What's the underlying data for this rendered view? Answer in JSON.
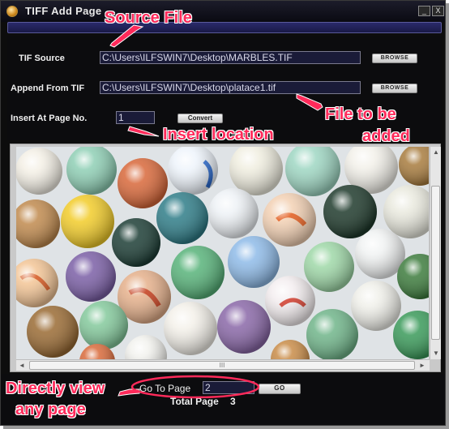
{
  "window": {
    "title": "TIFF Add Page",
    "minimize_glyph": "_",
    "close_glyph": "X"
  },
  "form": {
    "tif_source_label": "TIF Source",
    "tif_source_value": "C:\\Users\\ILFSWIN7\\Desktop\\MARBLES.TIF",
    "append_label": "Append From TIF",
    "append_value": "C:\\Users\\ILFSWIN7\\Desktop\\platace1.tif",
    "insert_label": "Insert At Page No.",
    "insert_value": "1",
    "browse_label": "BROWSE",
    "convert_label": "Convert"
  },
  "viewer": {
    "image_icon": "marbles-image",
    "scroll_up_glyph": "▲",
    "scroll_down_glyph": "▼",
    "scroll_left_glyph": "◄",
    "scroll_right_glyph": "►",
    "thumb_grip": "III"
  },
  "bottom": {
    "goto_label": "Go To Page",
    "goto_value": "2",
    "go_label": "GO",
    "total_label": "Total Page",
    "total_value": "3"
  },
  "annotations": {
    "source_file": "Source File",
    "file_to_be": "File to be",
    "added": "added",
    "insert_location": "Insert location",
    "directly_view": "Directly view",
    "any_page": "any page",
    "color": "#ff2a5a"
  }
}
